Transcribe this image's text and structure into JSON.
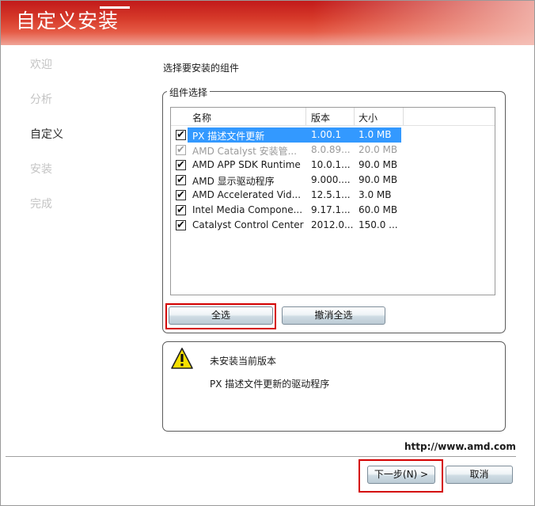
{
  "window": {
    "title": "自定义安装"
  },
  "steps": [
    {
      "label": "欢迎",
      "current": false
    },
    {
      "label": "分析",
      "current": false
    },
    {
      "label": "自定义",
      "current": true
    },
    {
      "label": "安装",
      "current": false
    },
    {
      "label": "完成",
      "current": false
    }
  ],
  "main": {
    "subtitle": "选择要安装的组件",
    "group_label": "组件选择",
    "columns": {
      "name": "名称",
      "version": "版本",
      "size": "大小"
    },
    "components": [
      {
        "name": "PX 描述文件更新",
        "version": "1.00.1",
        "size": "1.0 MB",
        "checked": true,
        "selected": true,
        "disabled": false
      },
      {
        "name": "AMD Catalyst 安装管...",
        "version": "8.0.89...",
        "size": "20.0 MB",
        "checked": true,
        "selected": false,
        "disabled": true
      },
      {
        "name": "AMD APP SDK Runtime",
        "version": "10.0.1...",
        "size": "90.0 MB",
        "checked": true,
        "selected": false,
        "disabled": false
      },
      {
        "name": "AMD 显示驱动程序",
        "version": "9.000....",
        "size": "90.0 MB",
        "checked": true,
        "selected": false,
        "disabled": false
      },
      {
        "name": "AMD Accelerated Vid...",
        "version": "12.5.1...",
        "size": "3.0 MB",
        "checked": true,
        "selected": false,
        "disabled": false
      },
      {
        "name": "Intel Media Compone...",
        "version": "9.17.1...",
        "size": "60.0 MB",
        "checked": true,
        "selected": false,
        "disabled": false
      },
      {
        "name": "Catalyst Control Center",
        "version": "2012.0...",
        "size": "150.0 ...",
        "checked": true,
        "selected": false,
        "disabled": false
      }
    ],
    "select_all_label": "全选",
    "deselect_all_label": "撤消全选",
    "info": {
      "title": "未安装当前版本",
      "description": "PX 描述文件更新的驱动程序"
    }
  },
  "footer": {
    "url": "http://www.amd.com",
    "next_label": "下一步(N) >",
    "cancel_label": "取消"
  },
  "colors": {
    "title_bar": "#c21a1a",
    "selection": "#3399ff",
    "highlight_outline": "#d40000",
    "warning_icon": "#f5e000"
  }
}
